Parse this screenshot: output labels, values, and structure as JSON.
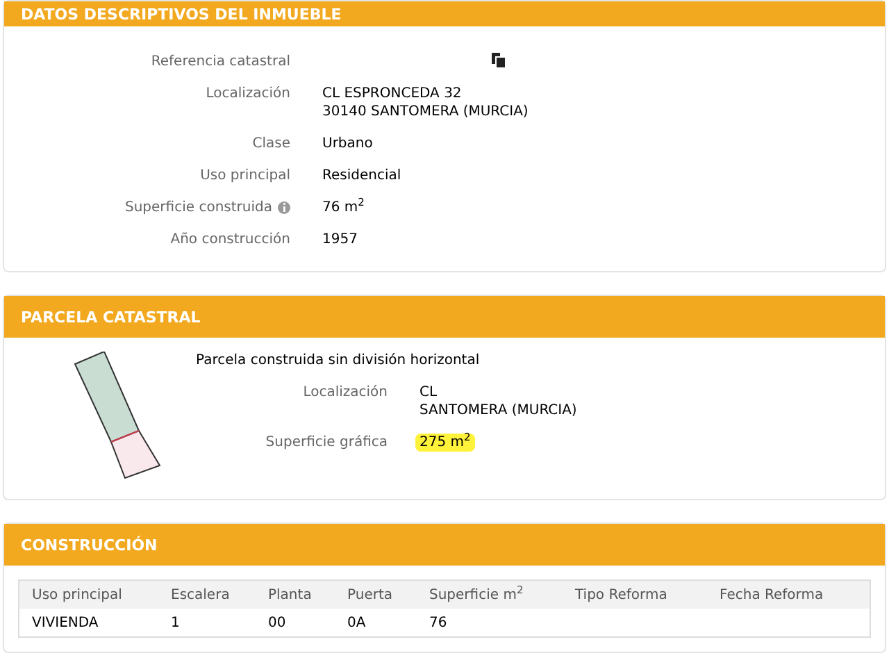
{
  "sections": [
    {
      "title": "DATOS DESCRIPTIVOS DEL INMUEBLE",
      "kind": "details",
      "rows": [
        {
          "label": "Referencia catastral",
          "copy": true
        },
        {
          "label": "Localización",
          "lines": [
            "CL ESPRONCEDA 32",
            "30140 SANTOMERA (MURCIA)"
          ]
        },
        {
          "label": "Clase",
          "value": "Urbano"
        },
        {
          "label": "Uso principal",
          "value": "Residencial"
        },
        {
          "label": "Superficie construida",
          "value": "76 m$^{2}$",
          "info": true
        },
        {
          "label": "Año construcción",
          "value": "1957"
        }
      ]
    },
    {
      "title": "PARCELA CATASTRAL",
      "kind": "parcel",
      "subtitle": "Parcela construida sin división horizontal",
      "rows": [
        {
          "label": "Localización",
          "lines": [
            "CL",
            "SANTOMERA (MURCIA)"
          ]
        },
        {
          "label": "Superficie gráfica",
          "value": "275 m$^{2}$",
          "highlighted": true
        }
      ]
    },
    {
      "title": "CONSTRUCCIÓN",
      "kind": "table",
      "columns": [
        "Uso principal",
        "Escalera",
        "Planta",
        "Puerta",
        "Superficie m$^{2}$",
        "Tipo Reforma",
        "Fecha Reforma"
      ],
      "rows": [
        [
          "VIVIENDA",
          "1",
          "00",
          "0A",
          "76",
          "",
          ""
        ]
      ]
    }
  ]
}
